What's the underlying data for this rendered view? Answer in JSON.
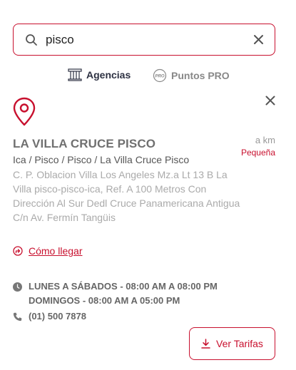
{
  "search": {
    "value": "pisco"
  },
  "tabs": [
    {
      "label": "Agencias",
      "icon": "building-icon",
      "active": true
    },
    {
      "label": "Puntos PRO",
      "icon": "pro-badge-icon",
      "active": false
    }
  ],
  "tab_pro_badge": "PRO",
  "agency": {
    "name": "LA VILLA CRUCE PISCO",
    "distance": "a km",
    "size": "Pequeña",
    "path": "Ica / Pisco / Pisco / La Villa Cruce Pisco",
    "address_lines": [
      "C. P. Oblacion Villa Los Angeles Mz.a Lt 13 B La",
      "Villa pisco-pisco-ica, Ref. A 100 Metros Con",
      "Dirección Al Sur Dedl Cruce Panamericana Antigua",
      "C/n Av. Fermín Tangüis"
    ],
    "directions_label": "Cómo llegar",
    "hours": [
      "LUNES A SÁBADOS - 08:00 AM A 08:00 PM",
      "DOMINGOS - 08:00 AM A 05:00 PM"
    ],
    "phone": "(01) 500 7878"
  },
  "buttons": {
    "tarifas": "Ver Tarifas"
  },
  "colors": {
    "accent": "#c8102e",
    "dark": "#2d3142",
    "muted": "#aaaaaa"
  }
}
